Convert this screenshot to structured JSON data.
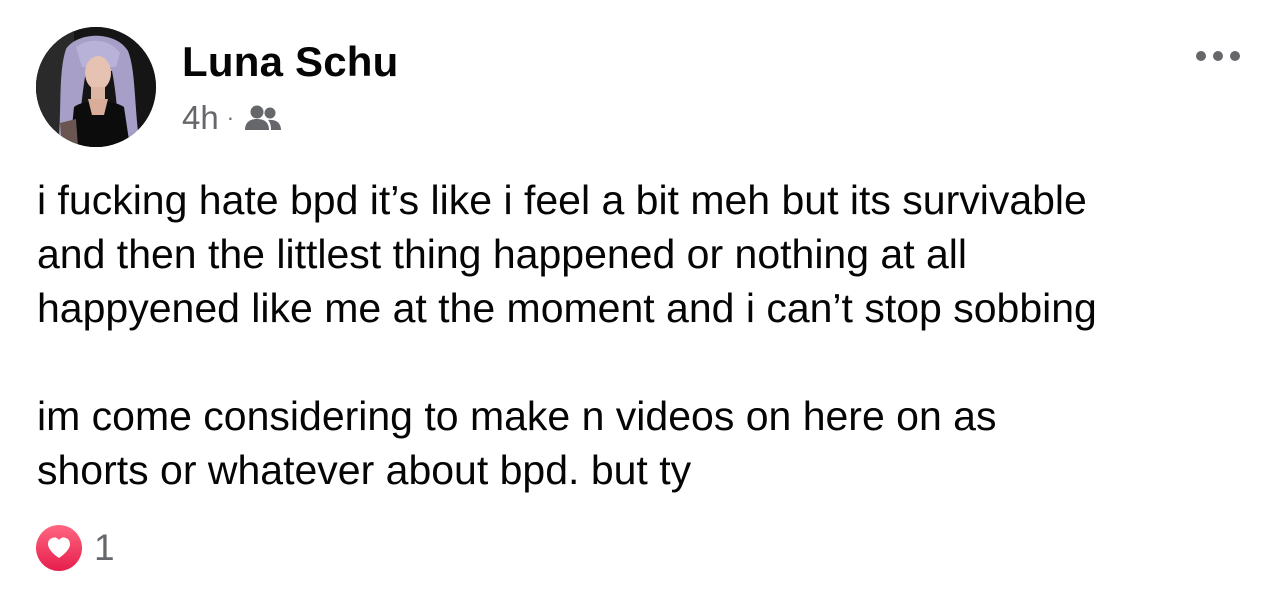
{
  "post": {
    "author": {
      "name": "Luna Schu",
      "avatar": "profile-photo"
    },
    "time": "4h",
    "separator": "·",
    "audience_icon": "friends-icon",
    "more_icon": "more-horizontal-icon",
    "text_lines": [
      "i fucking hate bpd it’s like i feel a bit meh but its survivable",
      "and then the littlest thing happened or nothing at all",
      "happyened like me at the moment and i can’t stop sobbing",
      "",
      "im come considering to make n videos on here on as",
      "shorts or whatever about bpd. but ty"
    ],
    "reactions": {
      "icon": "love-reaction-icon",
      "count": "1"
    }
  },
  "colors": {
    "primary_text": "#050505",
    "secondary_text": "#65676b",
    "love_reaction": "#f33e58"
  }
}
